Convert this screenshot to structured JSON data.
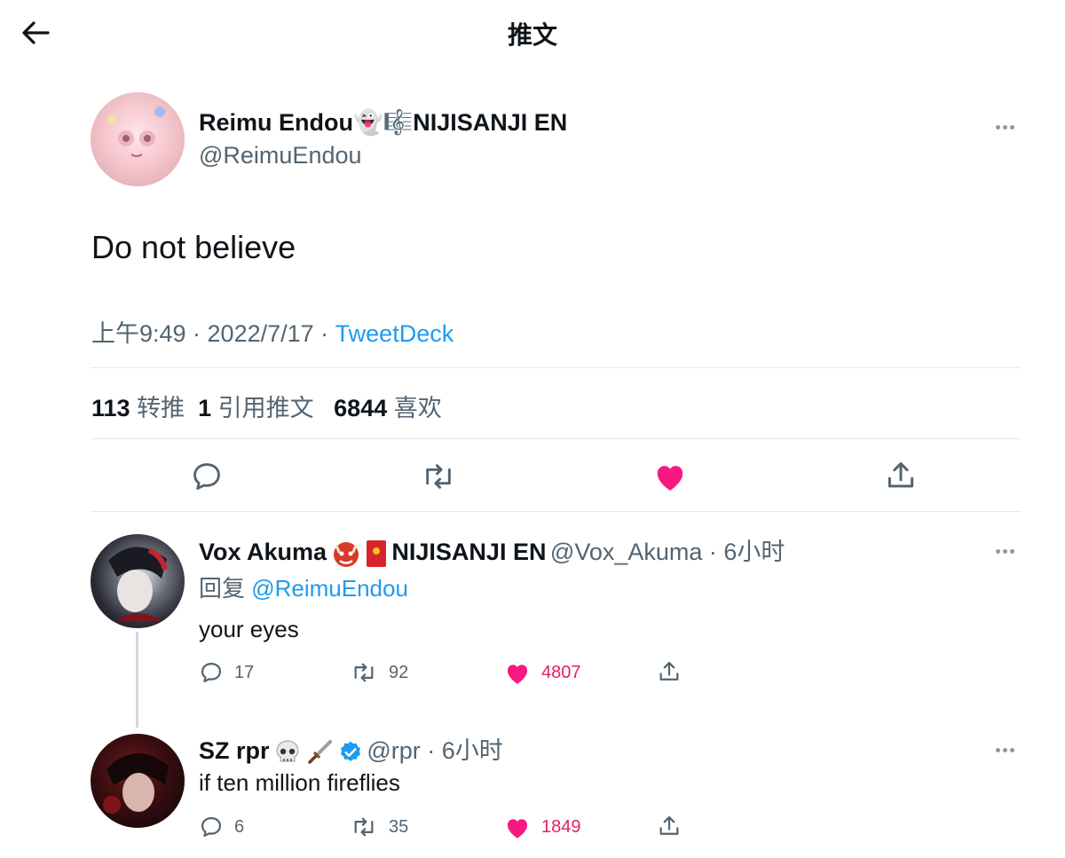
{
  "header": {
    "title": "推文"
  },
  "main_tweet": {
    "display_name": "Reimu Endou👻🎼NIJISANJI EN",
    "handle": "@ReimuEndou",
    "text": "Do not believe",
    "time": "上午9:49 · 2022/7/17 · ",
    "source": "TweetDeck",
    "stats": {
      "retweets": "113",
      "retweets_label": "转推",
      "quotes": "1",
      "quotes_label": "引用推文",
      "likes": "6844",
      "likes_label": "喜欢"
    }
  },
  "replies": [
    {
      "display_name": "Vox Akuma",
      "name_suffix": "NIJISANJI EN",
      "handle_time": "@Vox_Akuma · 6小时",
      "reply_prefix": "回复 ",
      "reply_to": "@ReimuEndou",
      "text": "your eyes",
      "reply_count": "17",
      "retweet_count": "92",
      "like_count": "4807"
    },
    {
      "display_name": "SZ rpr",
      "handle_time": "@rpr · 6小时",
      "text": "if ten million fireflies",
      "reply_count": "6",
      "retweet_count": "35",
      "like_count": "1849"
    }
  ],
  "colors": {
    "accent": "#1d9bf0",
    "like": "#f91880",
    "muted": "#536471"
  }
}
